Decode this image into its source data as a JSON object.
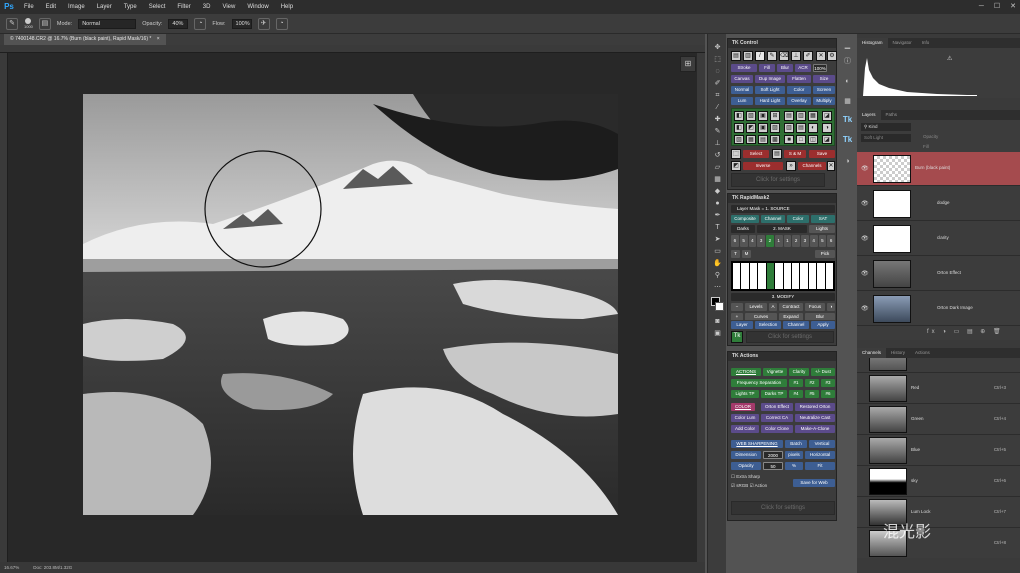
{
  "menubar": {
    "logo": "Ps",
    "items": [
      "File",
      "Edit",
      "Image",
      "Layer",
      "Type",
      "Select",
      "Filter",
      "3D",
      "View",
      "Window",
      "Help"
    ],
    "window_controls": [
      "─",
      "☐",
      "✕"
    ]
  },
  "options": {
    "brush_size": "1000",
    "mode_label": "Mode:",
    "mode_value": "Normal",
    "opacity_label": "Opacity:",
    "opacity_value": "40%",
    "flow_label": "Flow:",
    "flow_value": "100%"
  },
  "document": {
    "tab_title": "© 7400148.CR2 @ 16.7% (Burn (black paint), Rapid Mask/16) *",
    "close": "×"
  },
  "status": {
    "zoom": "16.67%",
    "doc": "Doc: 203.8M/1.32G"
  },
  "tk_control": {
    "title": "TK Control",
    "row2": [
      "Stroke",
      "Fill",
      "Blur",
      "ACR",
      "100%"
    ],
    "row3": [
      "Canvas",
      "Dup Image",
      "Flatten",
      "Size"
    ],
    "row4": [
      "Normal",
      "Soft Light",
      "Color",
      "Screen"
    ],
    "row5": [
      "Lum",
      "Hard Light",
      "Overlay",
      "Multiply"
    ],
    "select": "Select",
    "sm": "S & M",
    "save": "Save",
    "inverse": "Inverse",
    "channels": "Channels",
    "click_settings": "Click for settings"
  },
  "rapidmask": {
    "title": "TK RapidMask2",
    "source_label": "Layer Mask = 1. SOURCE",
    "source_btns": [
      "Composite",
      "Channel",
      "Color",
      "SAT"
    ],
    "mask_label": "2. MASK",
    "darks": "Darks",
    "lights": "Lights",
    "numbers": [
      "6",
      "5",
      "4",
      "3",
      "2",
      "1",
      "1",
      "2",
      "3",
      "4",
      "5",
      "6"
    ],
    "m_row": [
      "T",
      "M"
    ],
    "pick": "Pick",
    "modify_label": "3. MODIFY",
    "modify_btns": [
      "Levels",
      "Contract",
      "Focus"
    ],
    "modify_btns2": [
      "Curves",
      "Expand",
      "Blur"
    ],
    "output_label": "4. OUTPUT",
    "output_btns": [
      "Layer",
      "Selection",
      "Channel",
      "Apply"
    ],
    "click_settings": "Click for settings"
  },
  "tk_actions": {
    "title": "TK Actions",
    "actions_label": "ACTIONS",
    "vignette": "Vignette",
    "clarity": "Clarity",
    "dust": "+/- Dust",
    "freq": "Frequency Separation",
    "num1": [
      "#1",
      "#2",
      "#3"
    ],
    "lights_tp": "Lights TP",
    "darks_tp": "Darks TP",
    "num2": [
      "#4",
      "#5",
      "#6"
    ],
    "color_label": "COLOR",
    "orton": "Orton Effect",
    "restored": "Restored Orton",
    "color_lum": "Color Lum",
    "correct_ca": "Correct CA",
    "neutralize": "Neutralize Cast",
    "add_color": "Add Color",
    "color_clone": "Color Clone",
    "make_a_clone": "Make-A-Clone",
    "web_label": "WEB SHARPENING",
    "batch": "Batch",
    "vertical": "Vertical",
    "dimension_label": "Dimension",
    "dimension_value": "2000",
    "pixels": "pixels",
    "horizontal": "Horizontal",
    "opacity_label": "Opacity",
    "opacity_value": "50",
    "pct": "%",
    "fit": "Fit",
    "extra_sharp": "Extra Sharp",
    "srgb": "sRGB",
    "action_chk": "Action",
    "save_web": "Save for Web",
    "click_settings": "Click for settings"
  },
  "right": {
    "hist_tabs": [
      "Histogram",
      "Navigator",
      "Info"
    ],
    "layers_tabs": [
      "Layers",
      "Paths"
    ],
    "kind": "Kind",
    "blend": "Soft Light",
    "opacity": "Opacity",
    "fill": "Fill",
    "layers": [
      {
        "name": "Burn (black paint)"
      },
      {
        "name": "dodge"
      },
      {
        "name": "clarity"
      },
      {
        "name": "Orton Effect"
      },
      {
        "name": "Orton Dark Image"
      }
    ],
    "channel_tabs": [
      "Channels",
      "History",
      "Actions"
    ],
    "channels": [
      {
        "name": "Red",
        "key": "Ctrl+3"
      },
      {
        "name": "Green",
        "key": "Ctrl+4"
      },
      {
        "name": "Blue",
        "key": "Ctrl+5"
      },
      {
        "name": "sky",
        "key": "Ctrl+6"
      },
      {
        "name": "Lum Lock",
        "key": "Ctrl+7"
      },
      {
        "name": "",
        "key": "Ctrl+8"
      }
    ],
    "watermark": "混光影"
  },
  "colors": {
    "selected_layer": "#a54b4e",
    "ps_blue": "#31a8ff"
  }
}
